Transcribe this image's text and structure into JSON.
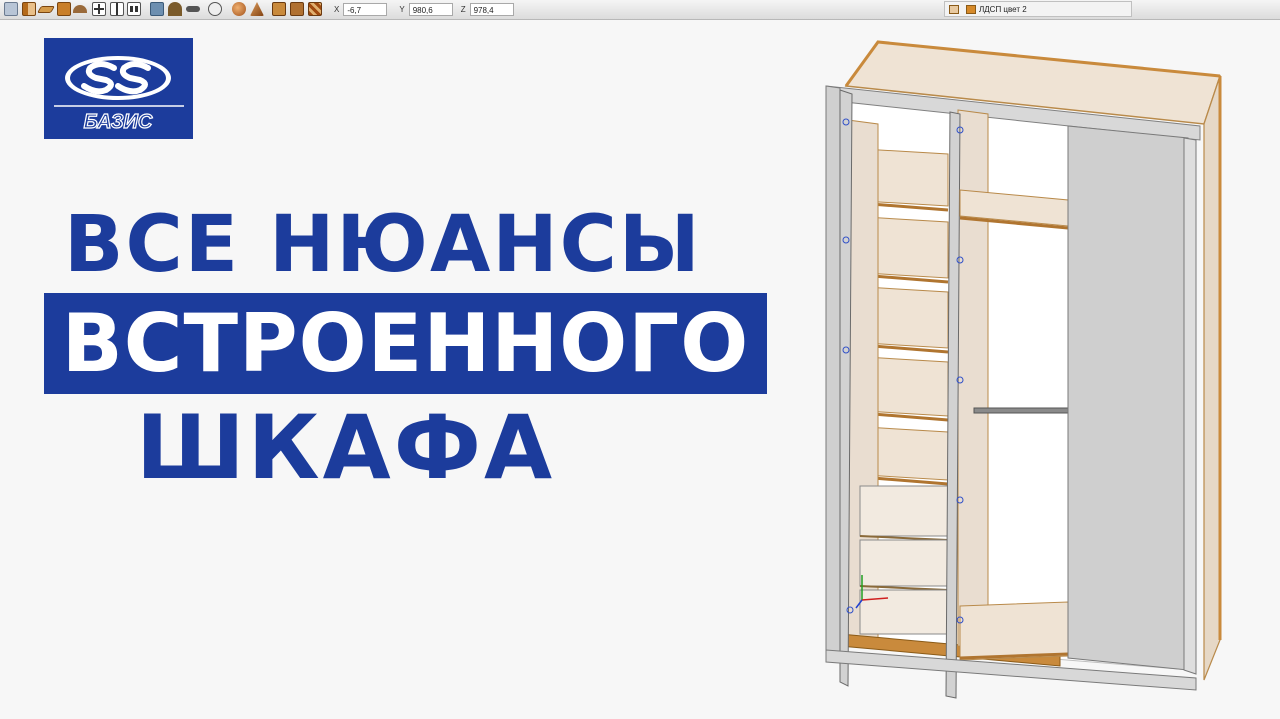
{
  "toolbar": {
    "coords": {
      "x_label": "X",
      "x_value": "-6,7",
      "y_label": "Y",
      "y_value": "980,6",
      "z_label": "Z",
      "z_value": "978,4"
    },
    "material": {
      "label": "ЛДСП цвет 2"
    }
  },
  "logo": {
    "text": "БАЗИС"
  },
  "headline": {
    "line1": "ВСЕ НЮАНСЫ",
    "line2": "ВСТРОЕННОГО",
    "line3": "ШКАФА"
  },
  "colors": {
    "brand_blue": "#1c3c9c",
    "panel_wood": "#efe3d4",
    "edge_orange": "#c98a3c",
    "door_gray": "#cfcfcf"
  },
  "icons": [
    "box-icon",
    "panel-icon",
    "shelf-icon",
    "board-icon",
    "arc-icon",
    "cross-frame-icon",
    "vertical-divider-icon",
    "horizontal-divider-icon",
    "chair-icon",
    "arch-icon",
    "rod-icon",
    "hardware-icon",
    "sphere-icon",
    "cone-icon",
    "box3d-icon",
    "drawer-icon",
    "texture-icon"
  ]
}
